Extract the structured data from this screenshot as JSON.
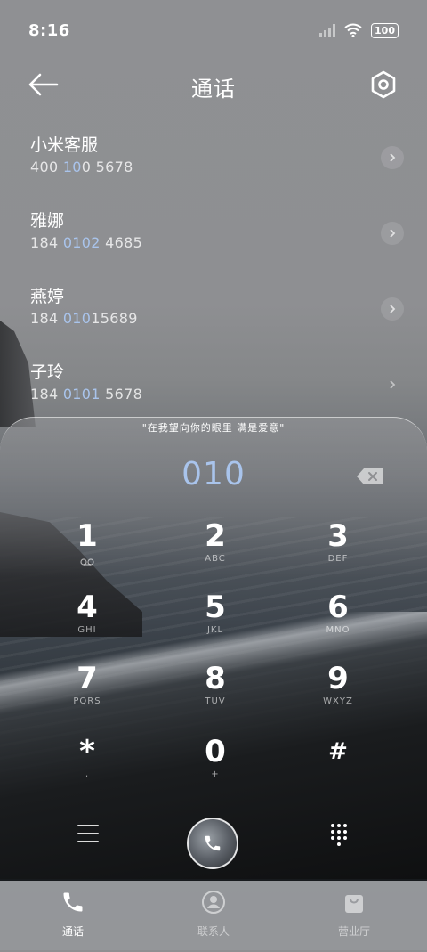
{
  "status_bar": {
    "time": "8:16",
    "battery": "100"
  },
  "header": {
    "title": "通话",
    "back_icon": "back-arrow-icon",
    "settings_icon": "settings-hexagon-icon"
  },
  "contacts": [
    {
      "name": "小米客服",
      "number_pre": "400 ",
      "number_hl": "10",
      "number_post": "0 5678"
    },
    {
      "name": "雅娜",
      "number_pre": "184 ",
      "number_hl": "0102",
      "number_post": " 4685"
    },
    {
      "name": "燕婷",
      "number_pre": "184 ",
      "number_hl": "010",
      "number_post": "15689"
    },
    {
      "name": "子玲",
      "number_pre": "184 ",
      "number_hl": "0101",
      "number_post": " 5678"
    }
  ],
  "dialer": {
    "quote": "\"在我望向你的眼里 满是爱意\"",
    "input": "010",
    "keys": [
      {
        "digit": "1",
        "letters": ""
      },
      {
        "digit": "2",
        "letters": "ABC"
      },
      {
        "digit": "3",
        "letters": "DEF"
      },
      {
        "digit": "4",
        "letters": "GHI"
      },
      {
        "digit": "5",
        "letters": "JKL"
      },
      {
        "digit": "6",
        "letters": "MNO"
      },
      {
        "digit": "7",
        "letters": "PQRS"
      },
      {
        "digit": "8",
        "letters": "TUV"
      },
      {
        "digit": "9",
        "letters": "WXYZ"
      },
      {
        "digit": "*",
        "letters": ","
      },
      {
        "digit": "0",
        "letters": "+"
      },
      {
        "digit": "#",
        "letters": ""
      }
    ]
  },
  "tabs": [
    {
      "label": "通话",
      "icon": "phone-icon",
      "active": true
    },
    {
      "label": "联系人",
      "icon": "contacts-icon",
      "active": false
    },
    {
      "label": "营业厅",
      "icon": "shopping-bag-icon",
      "active": false
    }
  ]
}
